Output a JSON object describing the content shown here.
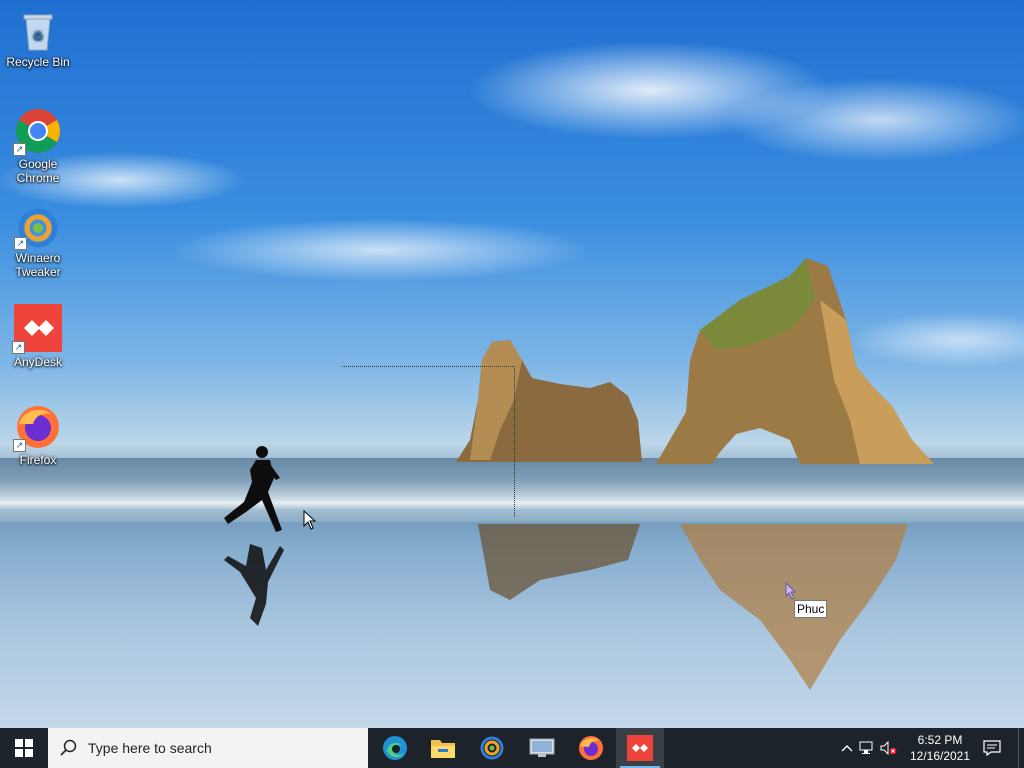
{
  "desktop": {
    "icons": [
      {
        "label": "Recycle Bin",
        "icon": "recycle-bin-icon"
      },
      {
        "label": "Google Chrome",
        "icon": "chrome-icon"
      },
      {
        "label": "Winaero Tweaker",
        "icon": "winaero-tweaker-icon"
      },
      {
        "label": "AnyDesk",
        "icon": "anydesk-icon"
      },
      {
        "label": "Firefox",
        "icon": "firefox-icon"
      }
    ],
    "tooltip": "Phuc"
  },
  "taskbar": {
    "start_icon": "windows-start-icon",
    "search_placeholder": "Type here to search",
    "apps": [
      {
        "name": "Microsoft Edge",
        "icon": "edge-icon",
        "active": false
      },
      {
        "name": "File Explorer",
        "icon": "file-explorer-icon",
        "active": false
      },
      {
        "name": "Winaero Tweaker",
        "icon": "winaero-tweaker-icon",
        "active": false
      },
      {
        "name": "Remote Desktop",
        "icon": "remote-desktop-icon",
        "active": false
      },
      {
        "name": "Firefox",
        "icon": "firefox-icon",
        "active": false
      },
      {
        "name": "AnyDesk",
        "icon": "anydesk-icon",
        "active": true
      }
    ],
    "tray": {
      "icons": [
        "chevron-up-icon",
        "network-icon",
        "volume-muted-icon",
        "notification-icon"
      ]
    },
    "clock": {
      "time": "6:52 PM",
      "date": "12/16/2021"
    }
  },
  "colors": {
    "taskbar": "#1d232a",
    "anydesk": "#ef443b",
    "accent": "#76b9ed"
  }
}
